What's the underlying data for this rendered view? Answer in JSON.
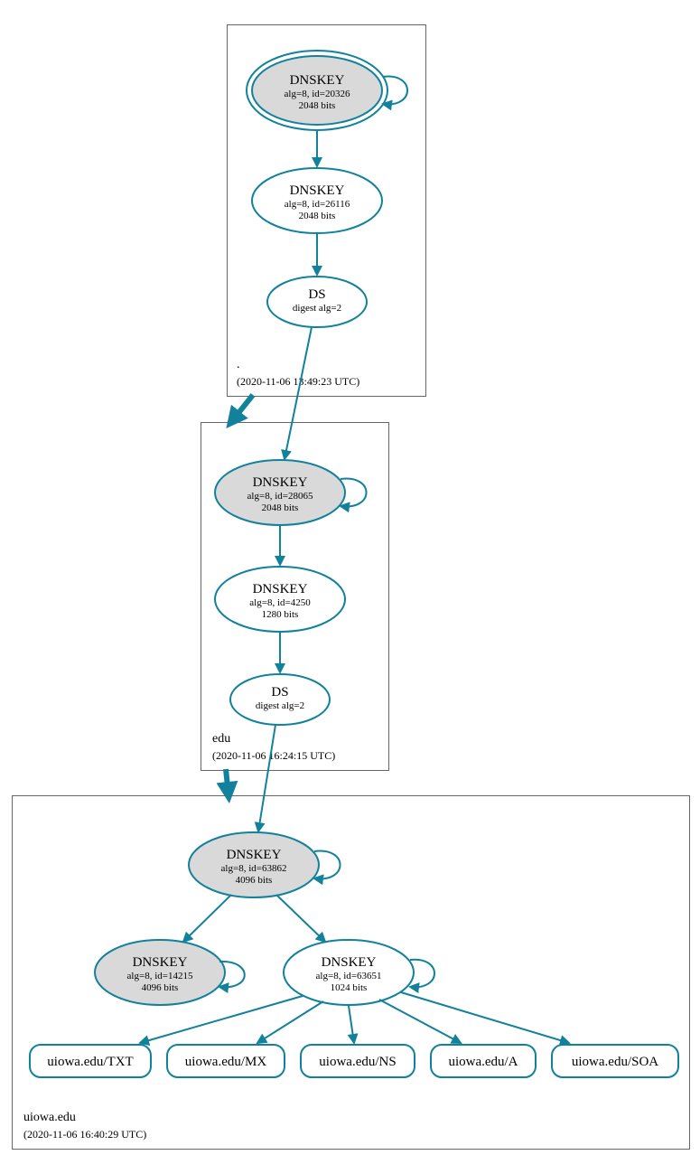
{
  "zones": {
    "root": {
      "label": ".",
      "timestamp": "(2020-11-06 13:49:23 UTC)",
      "nodes": {
        "ksk": {
          "title": "DNSKEY",
          "line1": "alg=8, id=20326",
          "line2": "2048 bits"
        },
        "zsk": {
          "title": "DNSKEY",
          "line1": "alg=8, id=26116",
          "line2": "2048 bits"
        },
        "ds": {
          "title": "DS",
          "line1": "digest alg=2"
        }
      }
    },
    "edu": {
      "label": "edu",
      "timestamp": "(2020-11-06 16:24:15 UTC)",
      "nodes": {
        "ksk": {
          "title": "DNSKEY",
          "line1": "alg=8, id=28065",
          "line2": "2048 bits"
        },
        "zsk": {
          "title": "DNSKEY",
          "line1": "alg=8, id=4250",
          "line2": "1280 bits"
        },
        "ds": {
          "title": "DS",
          "line1": "digest alg=2"
        }
      }
    },
    "uiowa": {
      "label": "uiowa.edu",
      "timestamp": "(2020-11-06 16:40:29 UTC)",
      "nodes": {
        "ksk": {
          "title": "DNSKEY",
          "line1": "alg=8, id=63862",
          "line2": "4096 bits"
        },
        "ksk2": {
          "title": "DNSKEY",
          "line1": "alg=8, id=14215",
          "line2": "4096 bits"
        },
        "zsk": {
          "title": "DNSKEY",
          "line1": "alg=8, id=63651",
          "line2": "1024 bits"
        }
      },
      "rrsets": {
        "txt": "uiowa.edu/TXT",
        "mx": "uiowa.edu/MX",
        "ns": "uiowa.edu/NS",
        "a": "uiowa.edu/A",
        "soa": "uiowa.edu/SOA"
      }
    }
  }
}
